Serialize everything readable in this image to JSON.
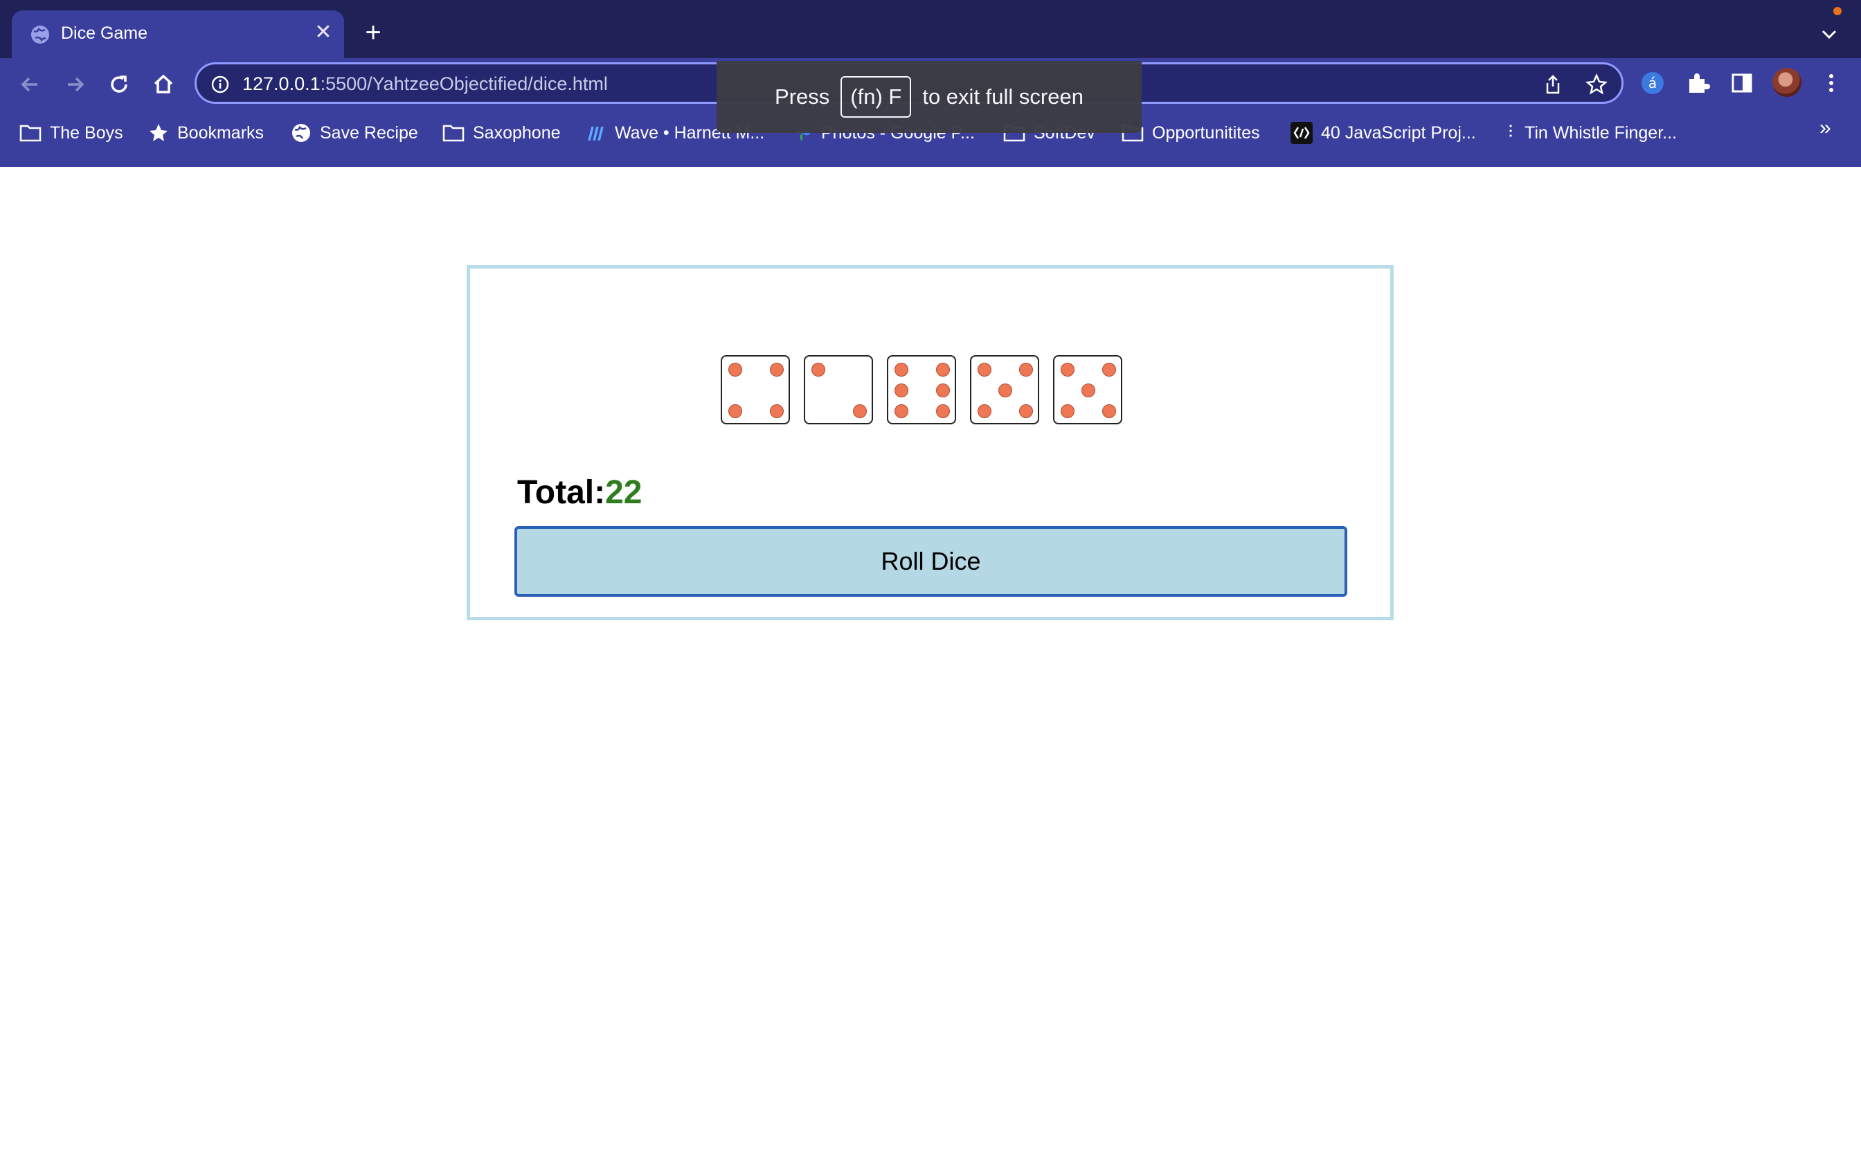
{
  "browser": {
    "tab_title": "Dice Game",
    "url_host": "127.0.0.1",
    "url_rest": ":5500/YahtzeeObjectified/dice.html",
    "fullscreen_hint": {
      "press": "Press",
      "key": "(fn) F",
      "rest": "to exit full screen"
    },
    "bookmarks": [
      {
        "label": "The Boys",
        "icon": "folder-icon"
      },
      {
        "label": "Bookmarks",
        "icon": "star-icon"
      },
      {
        "label": "Save Recipe",
        "icon": "globe-icon"
      },
      {
        "label": "Saxophone",
        "icon": "folder-icon"
      },
      {
        "label": "Wave • Harnett M...",
        "icon": "wave-icon"
      },
      {
        "label": "Photos - Google P...",
        "icon": "pinwheel-icon"
      },
      {
        "label": "SoftDev",
        "icon": "folder-icon"
      },
      {
        "label": "Opportunitites",
        "icon": "folder-icon"
      },
      {
        "label": "40 JavaScript Proj...",
        "icon": "brackets-icon"
      },
      {
        "label": "Tin Whistle Finger...",
        "icon": "dots-icon"
      }
    ],
    "overflow_label": "»"
  },
  "game": {
    "dice": [
      4,
      2,
      6,
      5,
      5
    ],
    "total_label": "Total:",
    "total_value": "22",
    "roll_button": "Roll Dice"
  },
  "colors": {
    "tabbar": "#1f2157",
    "toolbar": "#3a3f9e",
    "pip": "#ee7755",
    "total_value": "#2e7d1e",
    "button_bg": "#b4d8e4",
    "button_border": "#2a5fb8",
    "box_border": "#b8dde8"
  }
}
